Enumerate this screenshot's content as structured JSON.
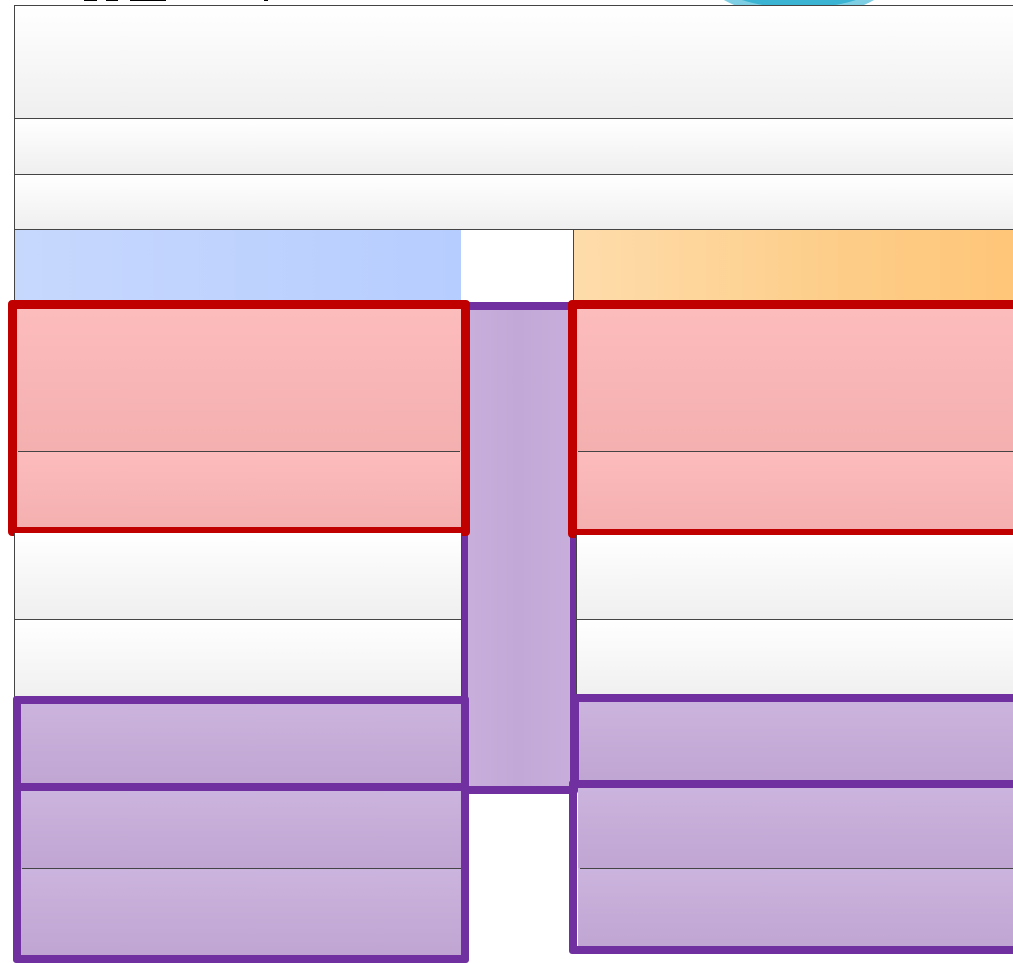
{
  "diagram": {
    "title_fragment": "",
    "colors": {
      "accent_red": "#c00000",
      "accent_purple": "#7030a0",
      "header_blue": "#b6cdff",
      "header_orange": "#ffc578",
      "fill_red": "#fdbcbc",
      "fill_purple": "#c6acda"
    },
    "sections": {
      "top_rows": [
        "",
        "",
        ""
      ],
      "left_column": {
        "header": "",
        "red_rows": [
          "",
          ""
        ],
        "plain_rows": [
          "",
          ""
        ],
        "purple_rows": [
          "",
          "",
          ""
        ]
      },
      "middle_connector": "",
      "right_column": {
        "header": "",
        "red_rows": [
          "",
          ""
        ],
        "plain_rows": [
          "",
          ""
        ],
        "purple_rows": [
          "",
          "",
          ""
        ]
      }
    }
  }
}
